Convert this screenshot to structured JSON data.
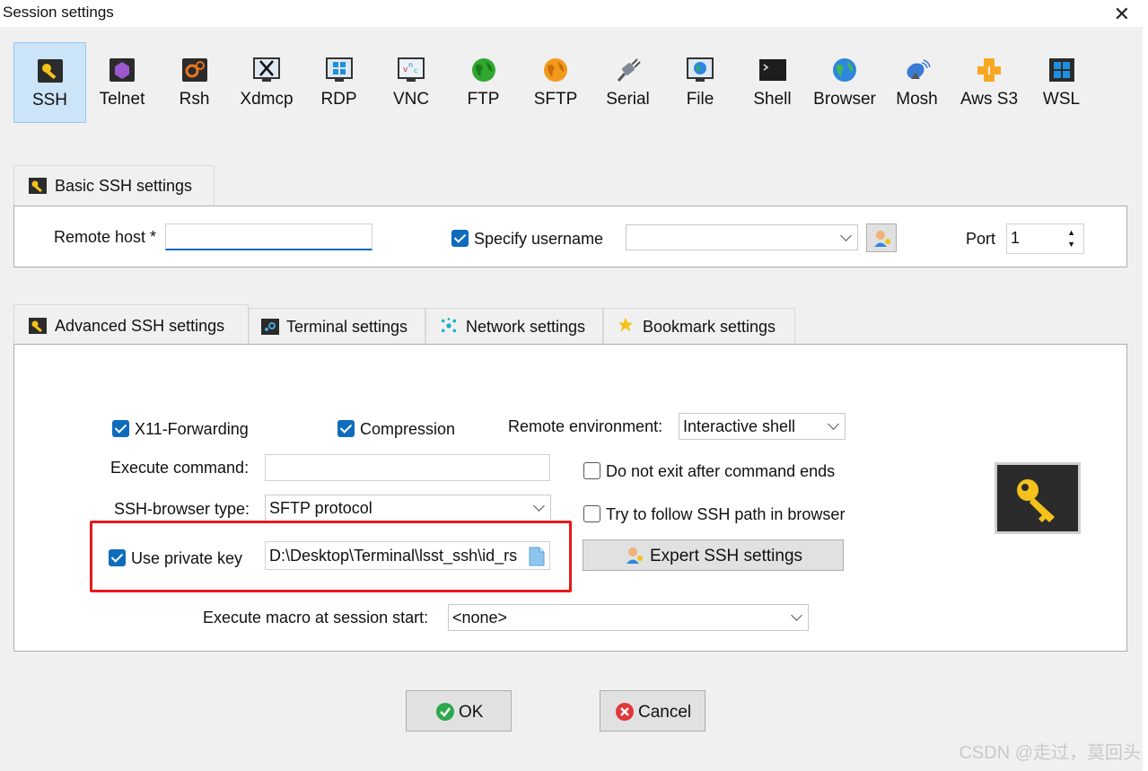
{
  "window": {
    "title": "Session settings",
    "close_glyph": "✕"
  },
  "session_types": [
    {
      "label": "SSH",
      "icon": "ssh-key-icon"
    },
    {
      "label": "Telnet",
      "icon": "telnet-icon"
    },
    {
      "label": "Rsh",
      "icon": "rsh-icon"
    },
    {
      "label": "Xdmcp",
      "icon": "xdmcp-icon"
    },
    {
      "label": "RDP",
      "icon": "rdp-icon"
    },
    {
      "label": "VNC",
      "icon": "vnc-icon"
    },
    {
      "label": "FTP",
      "icon": "ftp-globe-icon"
    },
    {
      "label": "SFTP",
      "icon": "sftp-globe-icon"
    },
    {
      "label": "Serial",
      "icon": "serial-plug-icon"
    },
    {
      "label": "File",
      "icon": "file-monitor-icon"
    },
    {
      "label": "Shell",
      "icon": "shell-terminal-icon"
    },
    {
      "label": "Browser",
      "icon": "browser-globe-icon"
    },
    {
      "label": "Mosh",
      "icon": "mosh-satellite-icon"
    },
    {
      "label": "Aws S3",
      "icon": "aws-s3-icon"
    },
    {
      "label": "WSL",
      "icon": "wsl-windows-icon"
    }
  ],
  "basic": {
    "tab_label": "Basic SSH settings",
    "remote_host_label": "Remote host *",
    "remote_host_value": "",
    "specify_username_label": "Specify username",
    "specify_username_checked": true,
    "username_value": "",
    "port_label": "Port",
    "port_value": "1"
  },
  "tabs": [
    {
      "label": "Advanced SSH settings",
      "icon": "wrench-icon"
    },
    {
      "label": "Terminal settings",
      "icon": "terminal-settings-icon"
    },
    {
      "label": "Network settings",
      "icon": "network-icon"
    },
    {
      "label": "Bookmark settings",
      "icon": "star-icon"
    }
  ],
  "advanced": {
    "x11_label": "X11-Forwarding",
    "compression_label": "Compression",
    "remote_env_label": "Remote environment:",
    "remote_env_value": "Interactive shell",
    "exec_cmd_label": "Execute command:",
    "exec_cmd_value": "",
    "do_not_exit_label": "Do not exit after command ends",
    "ssh_browser_label": "SSH-browser type:",
    "ssh_browser_value": "SFTP protocol",
    "follow_path_label": "Try to follow SSH path in browser",
    "private_key_label": "Use private key",
    "private_key_value": "D:\\Desktop\\Terminal\\lsst_ssh\\id_rs",
    "expert_label": "Expert SSH settings",
    "macro_label": "Execute macro at session start:",
    "macro_value": "<none>"
  },
  "buttons": {
    "ok": "OK",
    "cancel": "Cancel"
  },
  "watermark": "CSDN @走过，莫回头",
  "colors": {
    "accent": "#0f6cbd",
    "highlight": "#e8191b",
    "active_tab": "#cce4f7"
  }
}
